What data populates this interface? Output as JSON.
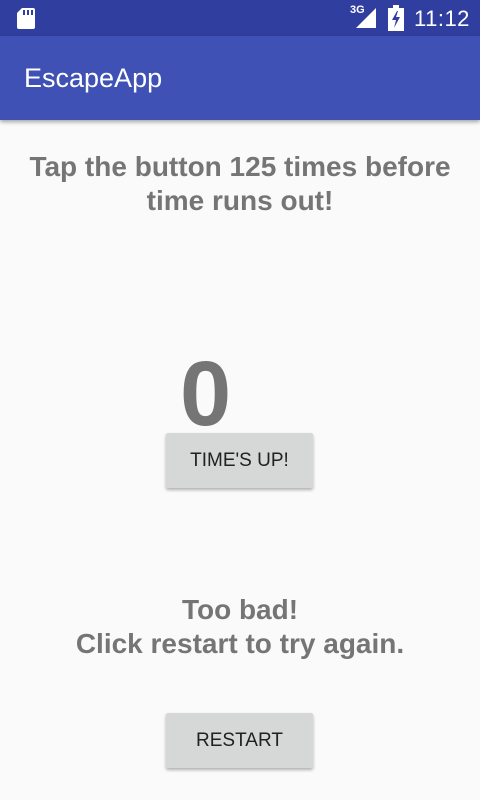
{
  "status_bar": {
    "network": "3G",
    "time": "11:12",
    "icons": [
      "sd-card-icon",
      "signal-icon",
      "battery-icon"
    ],
    "color": "#303f9f"
  },
  "app_bar": {
    "title": "EscapeApp",
    "color": "#3f51b5"
  },
  "main": {
    "instruction": "Tap the button 125 times before time runs out!",
    "counter": "0",
    "tap_button_label": "TIME'S UP!",
    "message_line1": "Too bad!",
    "message_line2": "Click restart to try again.",
    "restart_button_label": "RESTART",
    "text_color": "#757575"
  }
}
